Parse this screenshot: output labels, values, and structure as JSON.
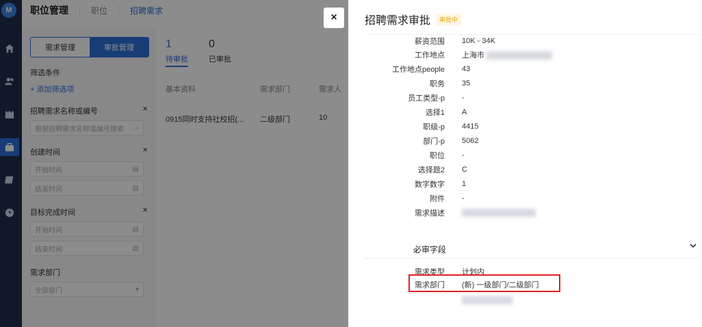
{
  "rail": {
    "logo_text": "M",
    "items": [
      "home-icon",
      "people-icon",
      "calendar-icon",
      "briefcase-icon",
      "report-icon",
      "clock-icon"
    ]
  },
  "topbar": {
    "title": "职位管理",
    "crumbs": [
      "职位",
      "招聘需求"
    ]
  },
  "filter": {
    "seg_left": "需求管理",
    "seg_right": "审批管理",
    "heading": "筛选条件",
    "add_filter": "+ 添加筛选项",
    "groups": [
      {
        "label": "招聘需求名称或编号",
        "inputs": [
          "根据招聘需求名称或编号搜索"
        ]
      },
      {
        "label": "创建时间",
        "inputs": [
          "开始时间",
          "结束时间"
        ]
      },
      {
        "label": "目标完成时间",
        "inputs": [
          "开始时间",
          "结束时间"
        ]
      },
      {
        "label": "需求部门",
        "inputs": [
          "全部部门"
        ]
      }
    ]
  },
  "content": {
    "tabs": [
      {
        "num": "1",
        "label": "待审批"
      },
      {
        "num": "0",
        "label": "已审批"
      }
    ],
    "headers": [
      "基本资料",
      "需求部门",
      "需求人"
    ],
    "row": [
      "0915同时支持社校招(...",
      "二级部门",
      "10"
    ]
  },
  "close_label": "×",
  "drawer": {
    "title": "招聘需求审批",
    "status": "审批中",
    "fields": [
      {
        "k": "薪资范围",
        "v": "10K - 34K"
      },
      {
        "k": "工作地点",
        "v": "上海市"
      },
      {
        "k": "工作地点people",
        "v": "43"
      },
      {
        "k": "职务",
        "v": "35"
      },
      {
        "k": "员工类型-p",
        "v": "-"
      },
      {
        "k": "选择1",
        "v": "A"
      },
      {
        "k": "职级-p",
        "v": "4415"
      },
      {
        "k": "部门-p",
        "v": "5062"
      },
      {
        "k": "职位",
        "v": "-"
      },
      {
        "k": "选择题2",
        "v": "C"
      },
      {
        "k": "数字数字",
        "v": "1"
      },
      {
        "k": "附件",
        "v": "-"
      },
      {
        "k": "需求描述",
        "v": ""
      }
    ],
    "section_title": "必审字段",
    "required_fields": [
      {
        "k": "需求类型",
        "v": "计划内"
      },
      {
        "k": "需求部门",
        "v": "(新) 一级部门/二级部门"
      }
    ]
  },
  "colors": {
    "accent": "#2d6fd8",
    "highlight": "#e02020",
    "badge": "#e8a317"
  }
}
